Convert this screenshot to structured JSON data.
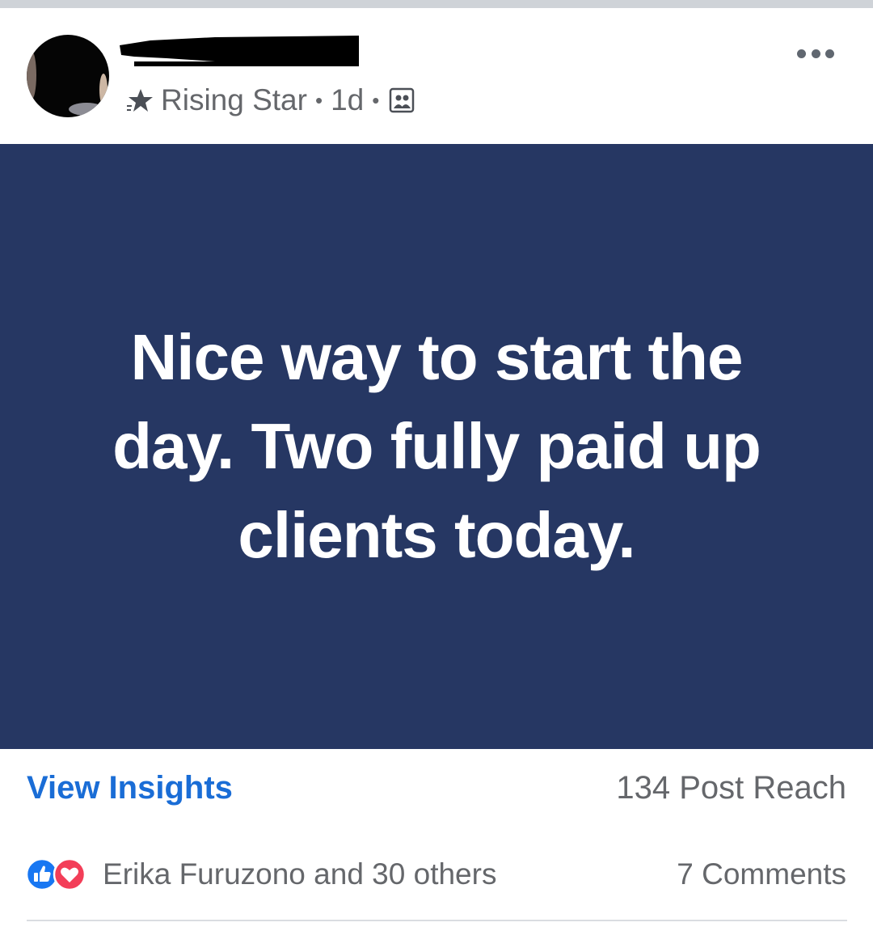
{
  "post": {
    "author_badge": "Rising Star",
    "separator": "•",
    "time_ago": "1d",
    "audience_icon": "audience-group-icon",
    "more_icon": "more-options-icon",
    "body_text": "Nice way to start the day. Two fully paid up clients today.",
    "banner_color": "#263763"
  },
  "insights": {
    "view_label": "View Insights",
    "reach_text": "134 Post Reach"
  },
  "engagement": {
    "reaction_icons": [
      "like-icon",
      "love-icon"
    ],
    "reactions_text": "Erika Furuzono and 30 others",
    "comments_text": "7 Comments"
  },
  "colors": {
    "link_blue": "#1a6dd6",
    "meta_gray": "#65676b",
    "like_blue": "#1877f2",
    "love_red": "#f33e58"
  }
}
